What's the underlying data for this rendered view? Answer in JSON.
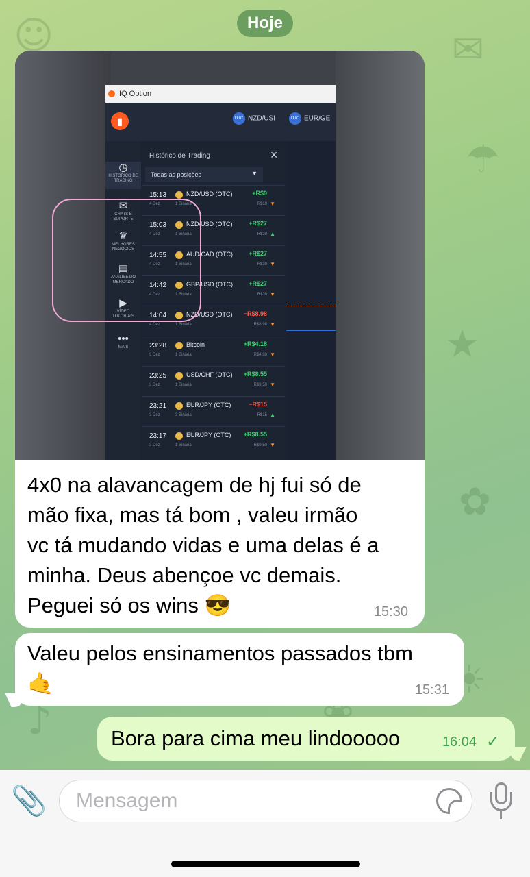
{
  "date_separator": "Hoje",
  "messages": [
    {
      "text": "4x0 na alavancagem de hj fui só de mão fixa, mas tá bom , valeu irmão vc tá mudando vidas e uma delas é a minha. Deus abençoe vc demais. Peguei só os wins 😎",
      "lines": [
        "4x0 na alavancagem de hj fui só de",
        "mão fixa, mas tá bom , valeu irmão",
        "vc tá mudando vidas e uma delas é a",
        "minha. Deus abençoe vc demais.",
        "Peguei só os wins 😎"
      ],
      "time": "15:30"
    },
    {
      "text": "Valeu pelos ensinamentos passados tbm 🤙",
      "lines": [
        "Valeu pelos ensinamentos passados tbm",
        "🤙"
      ],
      "time": "15:31"
    },
    {
      "text": "Bora para cima meu lindooooo",
      "time": "16:04",
      "status": "sent"
    }
  ],
  "photo": {
    "window_title": "IQ Option",
    "header_tabs": [
      {
        "label": "NZD/USI"
      },
      {
        "label": "EUR/GE"
      }
    ],
    "sidebar": [
      {
        "label": "HISTÓRICO DE TRADING",
        "icon": "history-icon"
      },
      {
        "label": "CHATS E SUPORTE",
        "icon": "chat-icon"
      },
      {
        "label": "MELHORES NEGÓCIOS",
        "icon": "trophy-icon"
      },
      {
        "label": "ANÁLISE DO MERCADO",
        "icon": "news-icon"
      },
      {
        "label": "VÍDEO TUTORIAIS",
        "icon": "play-icon"
      },
      {
        "label": "MAIS",
        "icon": "more-icon"
      }
    ],
    "panel_title": "Histórico de Trading",
    "filter": "Todas as posições",
    "trades": [
      {
        "time": "15:13",
        "date": "4 Dez",
        "pair": "NZD/USD (OTC)",
        "kind": "1 Binária",
        "result": "+R$9",
        "stake": "R$10",
        "outcome": "win",
        "direction": "down"
      },
      {
        "time": "15:03",
        "date": "4 Dez",
        "pair": "NZD/USD (OTC)",
        "kind": "1 Binária",
        "result": "+R$27",
        "stake": "R$30",
        "outcome": "win",
        "direction": "up"
      },
      {
        "time": "14:55",
        "date": "4 Dez",
        "pair": "AUD/CAD (OTC)",
        "kind": "1 Binária",
        "result": "+R$27",
        "stake": "R$30",
        "outcome": "win",
        "direction": "down"
      },
      {
        "time": "14:42",
        "date": "4 Dez",
        "pair": "GBP/USD (OTC)",
        "kind": "1 Binária",
        "result": "+R$27",
        "stake": "R$30",
        "outcome": "win",
        "direction": "down"
      },
      {
        "time": "14:04",
        "date": "4 Dez",
        "pair": "NZD/USD (OTC)",
        "kind": "1 Binária",
        "result": "−R$8.98",
        "stake": "R$8.98",
        "outcome": "loss",
        "direction": "down"
      },
      {
        "time": "23:28",
        "date": "3 Dez",
        "pair": "Bitcoin",
        "kind": "1 Binária",
        "result": "+R$4.18",
        "stake": "R$4.80",
        "outcome": "win",
        "direction": "down"
      },
      {
        "time": "23:25",
        "date": "3 Dez",
        "pair": "USD/CHF (OTC)",
        "kind": "1 Binária",
        "result": "+R$8.55",
        "stake": "R$9.50",
        "outcome": "win",
        "direction": "down"
      },
      {
        "time": "23:21",
        "date": "3 Dez",
        "pair": "EUR/JPY (OTC)",
        "kind": "3 Binária",
        "result": "−R$15",
        "stake": "R$15",
        "outcome": "loss",
        "direction": "up"
      },
      {
        "time": "23:17",
        "date": "3 Dez",
        "pair": "EUR/JPY (OTC)",
        "kind": "1 Binária",
        "result": "+R$8.55",
        "stake": "R$9.50",
        "outcome": "win",
        "direction": "down"
      }
    ]
  },
  "composer": {
    "placeholder": "Mensagem"
  },
  "colors": {
    "incoming_bubble": "#ffffff",
    "outgoing_bubble": "#e3fbc9",
    "accent_green": "#3fa34d",
    "trade_win": "#3bd36d",
    "trade_loss": "#ff5b4a",
    "highlight_circle": "#f2a9d6"
  }
}
